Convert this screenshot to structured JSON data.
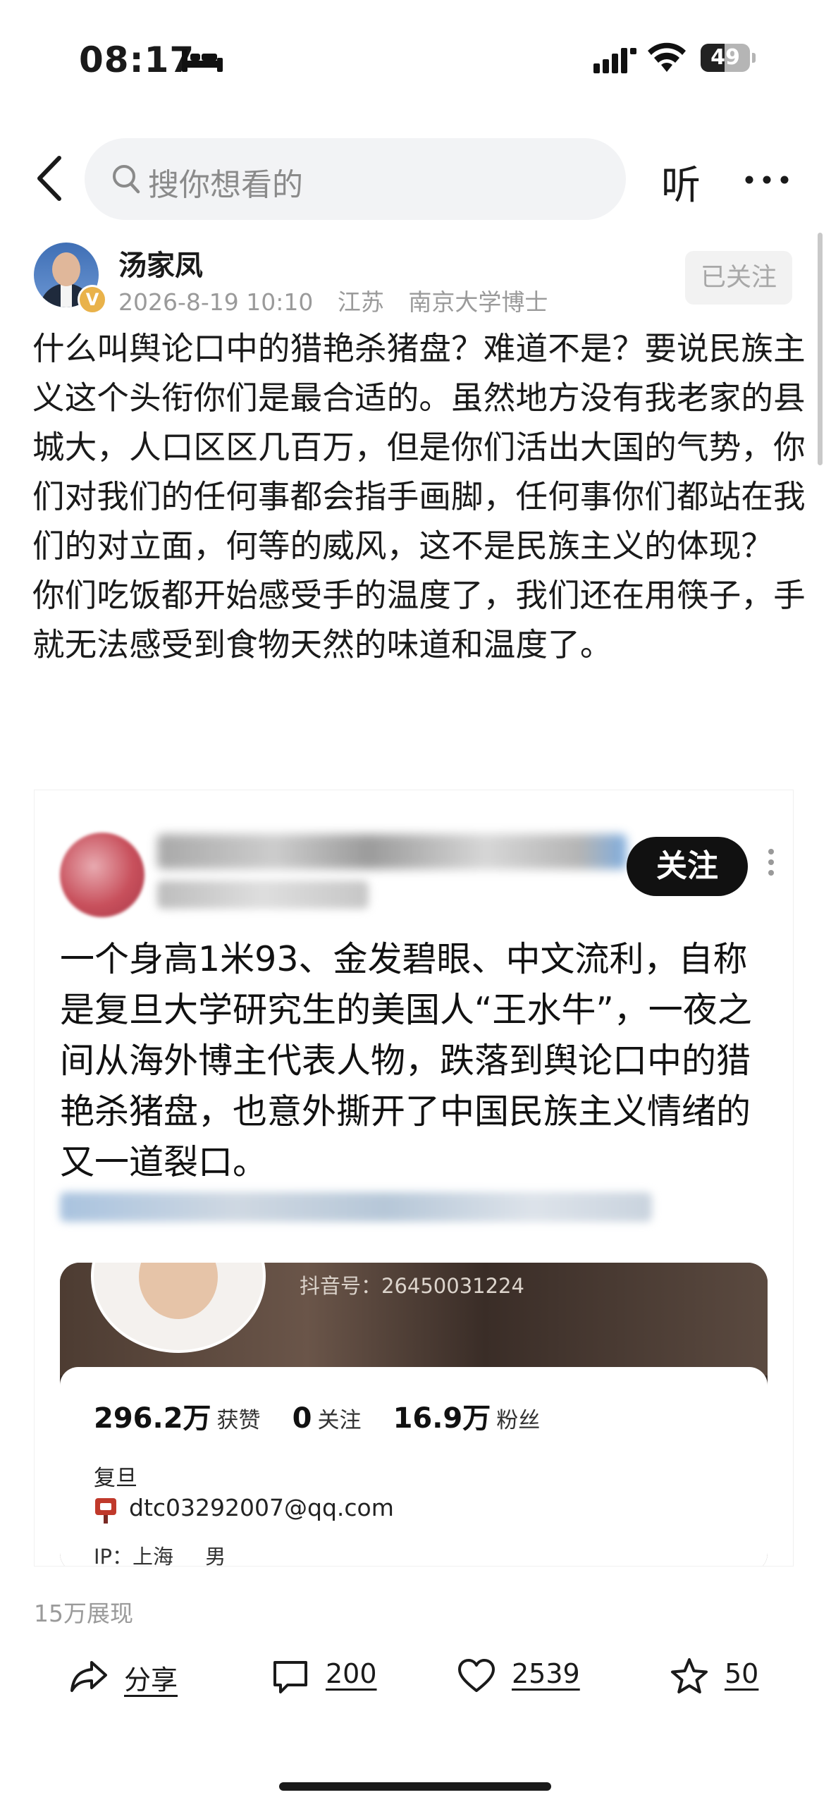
{
  "status_bar": {
    "time": "08:17",
    "battery": "49",
    "battery_level": 0.49
  },
  "search": {
    "placeholder": "搜你想看的"
  },
  "header": {
    "listen_label": "听"
  },
  "author": {
    "name": "汤家凤",
    "date": "2026-8-19 10:10",
    "location": "江苏",
    "title": "南京大学博士",
    "follow_status": "已关注",
    "verified": "V"
  },
  "post": {
    "paragraphs": [
      "什么叫舆论口中的猎艳杀猪盘？难道不是？要说民族主义这个头衔你们是最合适的。虽然地方没有我老家的县城大，人口区区几百万，但是你们活出大国的气势，你们对我们的任何事都会指手画脚，任何事你们都站在我们的对立面，何等的威风，这不是民族主义的体现？",
      "你们吃饭都开始感受手的温度了，我们还在用筷子，手就无法感受到食物天然的味道和温度了。"
    ]
  },
  "embed": {
    "follow_label": "关注",
    "text": "一个身高1米93、金发碧眼、中文流利，自称是复旦大学研究生的美国人“王水牛”，一夜之间从海外博主代表人物，跌落到舆论口中的猎艳杀猪盘，也意外撕开了中国民族主义情绪的又一道裂口。",
    "profile": {
      "douyin_id": "抖音号：26450031224",
      "likes_num": "296.2万",
      "likes_label": "获赞",
      "following_num": "0",
      "following_label": "关注",
      "fans_num": "16.9万",
      "fans_label": "粉丝",
      "school": "复旦",
      "email": "dtc03292007@qq.com",
      "ip": "IP：上海",
      "gender": "男"
    }
  },
  "stats": {
    "impressions": "15万展现"
  },
  "actions": {
    "share": "分享",
    "comments": "200",
    "likes": "2539",
    "favorites": "50"
  },
  "colors": {
    "follow_button_bg": "#111111",
    "verified_badge": "#e9b24a",
    "muted_text": "#9a9a9a"
  }
}
